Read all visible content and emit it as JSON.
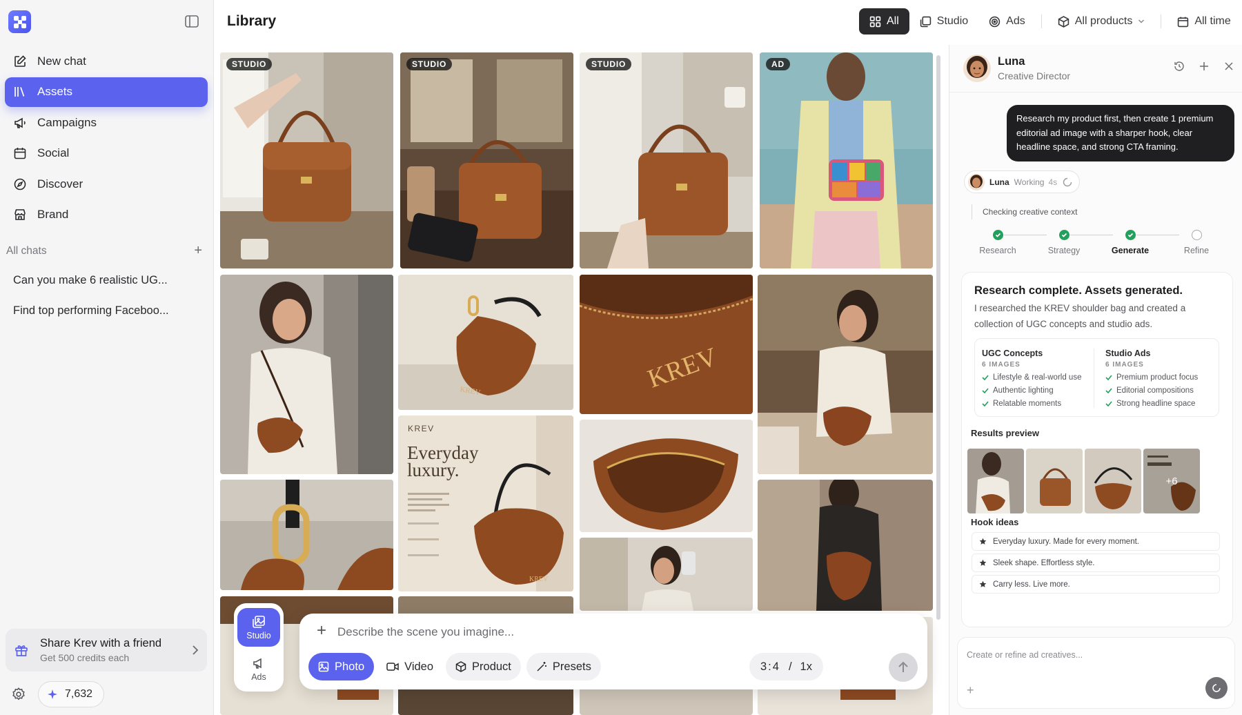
{
  "sidebar": {
    "nav": [
      {
        "label": "New chat",
        "icon": "edit-icon"
      },
      {
        "label": "Assets",
        "icon": "library-icon"
      },
      {
        "label": "Campaigns",
        "icon": "megaphone-icon"
      },
      {
        "label": "Social",
        "icon": "calendar-icon"
      },
      {
        "label": "Discover",
        "icon": "compass-icon"
      },
      {
        "label": "Brand",
        "icon": "store-icon"
      }
    ],
    "chats_label": "All chats",
    "chats": [
      "Can you make 6 realistic UG...",
      "Find top performing Faceboo..."
    ],
    "share": {
      "title": "Share Krev with a friend",
      "subtitle": "Get 500 credits each"
    },
    "credits": "7,632"
  },
  "header": {
    "title": "Library",
    "filters": {
      "all": "All",
      "studio": "Studio",
      "ads": "Ads",
      "products": "All products",
      "time": "All time"
    }
  },
  "grid": {
    "badges": [
      "STUDIO",
      "STUDIO",
      "STUDIO",
      "AD"
    ],
    "brand_text": "KREV",
    "poster": {
      "brand": "KREV",
      "headline_1": "Everyday",
      "headline_2": "luxury."
    }
  },
  "composer": {
    "mode_studio": "Studio",
    "mode_ads": "Ads",
    "placeholder": "Describe the scene you imagine...",
    "chips": {
      "photo": "Photo",
      "video": "Video",
      "product": "Product",
      "presets": "Presets"
    },
    "ratio": "3:4",
    "ratio_sep": "/",
    "multiplier": "1x"
  },
  "panel": {
    "agent_name": "Luna",
    "agent_role": "Creative Director",
    "user_message": "Research my product first, then create 1 premium editorial ad image with a sharper hook, clear headline space, and strong CTA framing.",
    "status": {
      "name": "Luna",
      "state": "Working",
      "time": "4s"
    },
    "checking": "Checking creative context",
    "steps": [
      {
        "label": "Research",
        "done": true
      },
      {
        "label": "Strategy",
        "done": true
      },
      {
        "label": "Generate",
        "done": true
      },
      {
        "label": "Refine",
        "done": false
      }
    ],
    "result": {
      "title": "Research complete. Assets generated.",
      "body": "I researched the KREV shoulder bag and created a collection of UGC concepts and studio ads.",
      "ugc": {
        "title": "UGC Concepts",
        "count": "6 IMAGES",
        "items": [
          "Lifestyle & real-world use",
          "Authentic lighting",
          "Relatable moments"
        ]
      },
      "studio": {
        "title": "Studio Ads",
        "count": "6 IMAGES",
        "items": [
          "Premium product focus",
          "Editorial compositions",
          "Strong headline space"
        ]
      },
      "preview_label": "Results preview",
      "more": "+6",
      "hooks_label": "Hook ideas",
      "hooks": [
        "Everyday luxury. Made for every moment.",
        "Sleek shape. Effortless style.",
        "Carry less. Live more."
      ]
    },
    "input_placeholder": "Create or refine ad creatives..."
  },
  "colors": {
    "accent": "#5b63ee",
    "bag_brown": "#8a4a22",
    "success": "#22a05c"
  }
}
